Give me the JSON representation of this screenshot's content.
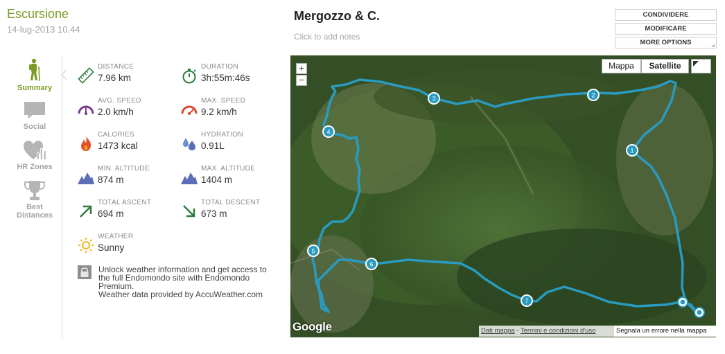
{
  "workout": {
    "sport": "Escursione",
    "date": "14-lug-2013 10.44"
  },
  "nav": {
    "summary": "Summary",
    "social": "Social",
    "hr_zones": "HR Zones",
    "best_distances_1": "Best",
    "best_distances_2": "Distances"
  },
  "stats": {
    "distance": {
      "label": "DISTANCE",
      "value": "7.96 km"
    },
    "duration": {
      "label": "DURATION",
      "value": "3h:55m:46s"
    },
    "avg_speed": {
      "label": "AVG. SPEED",
      "value": "2.0 km/h"
    },
    "max_speed": {
      "label": "MAX. SPEED",
      "value": "9.2 km/h"
    },
    "calories": {
      "label": "CALORIES",
      "value": "1473 kcal"
    },
    "hydration": {
      "label": "HYDRATION",
      "value": "0.91L"
    },
    "min_altitude": {
      "label": "MIN. ALTITUDE",
      "value": "874 m"
    },
    "max_altitude": {
      "label": "MAX. ALTITUDE",
      "value": "1404 m"
    },
    "total_ascent": {
      "label": "TOTAL ASCENT",
      "value": "694 m"
    },
    "total_descent": {
      "label": "TOTAL DESCENT",
      "value": "673 m"
    },
    "weather": {
      "label": "WEATHER",
      "value": "Sunny"
    }
  },
  "premium": {
    "line1": "Unlock weather information and get access to",
    "line2": "the full Endomondo site with Endomondo",
    "line3": "Premium.",
    "line4": "Weather data provided by AccuWeather.com"
  },
  "route": {
    "title": "Mergozzo & C.",
    "notes_placeholder": "Click to add notes"
  },
  "actions": {
    "share": "CONDIVIDERE",
    "edit": "MODIFICARE",
    "more": "MORE OPTIONS"
  },
  "map": {
    "zoom_in": "+",
    "zoom_out": "−",
    "type_map": "Mappa",
    "type_satellite": "Satellite",
    "logo": "Google",
    "data_link": "Dati mappa",
    "separator": " - ",
    "terms_link": "Termini e condizioni d'uso",
    "report_link": "Segnala un errore nella mappa",
    "markers": [
      "1",
      "2",
      "3",
      "4",
      "5",
      "6",
      "7"
    ]
  },
  "colors": {
    "brand_green": "#7a9c26",
    "route": "#2a9bc0",
    "icon_blue": "#5a6fb8",
    "icon_red": "#d9472f",
    "icon_green": "#2d7a3a",
    "icon_purple": "#7b3a8f"
  },
  "icons": {
    "distance": "ruler-icon",
    "duration": "stopwatch-icon",
    "avg_speed": "speedometer-icon",
    "max_speed": "speedometer-icon",
    "calories": "flame-icon",
    "hydration": "droplets-icon",
    "altitude": "mountain-icon",
    "ascent": "arrow-up-right-icon",
    "descent": "arrow-down-right-icon",
    "weather": "sun-icon",
    "premium": "lock-icon"
  }
}
